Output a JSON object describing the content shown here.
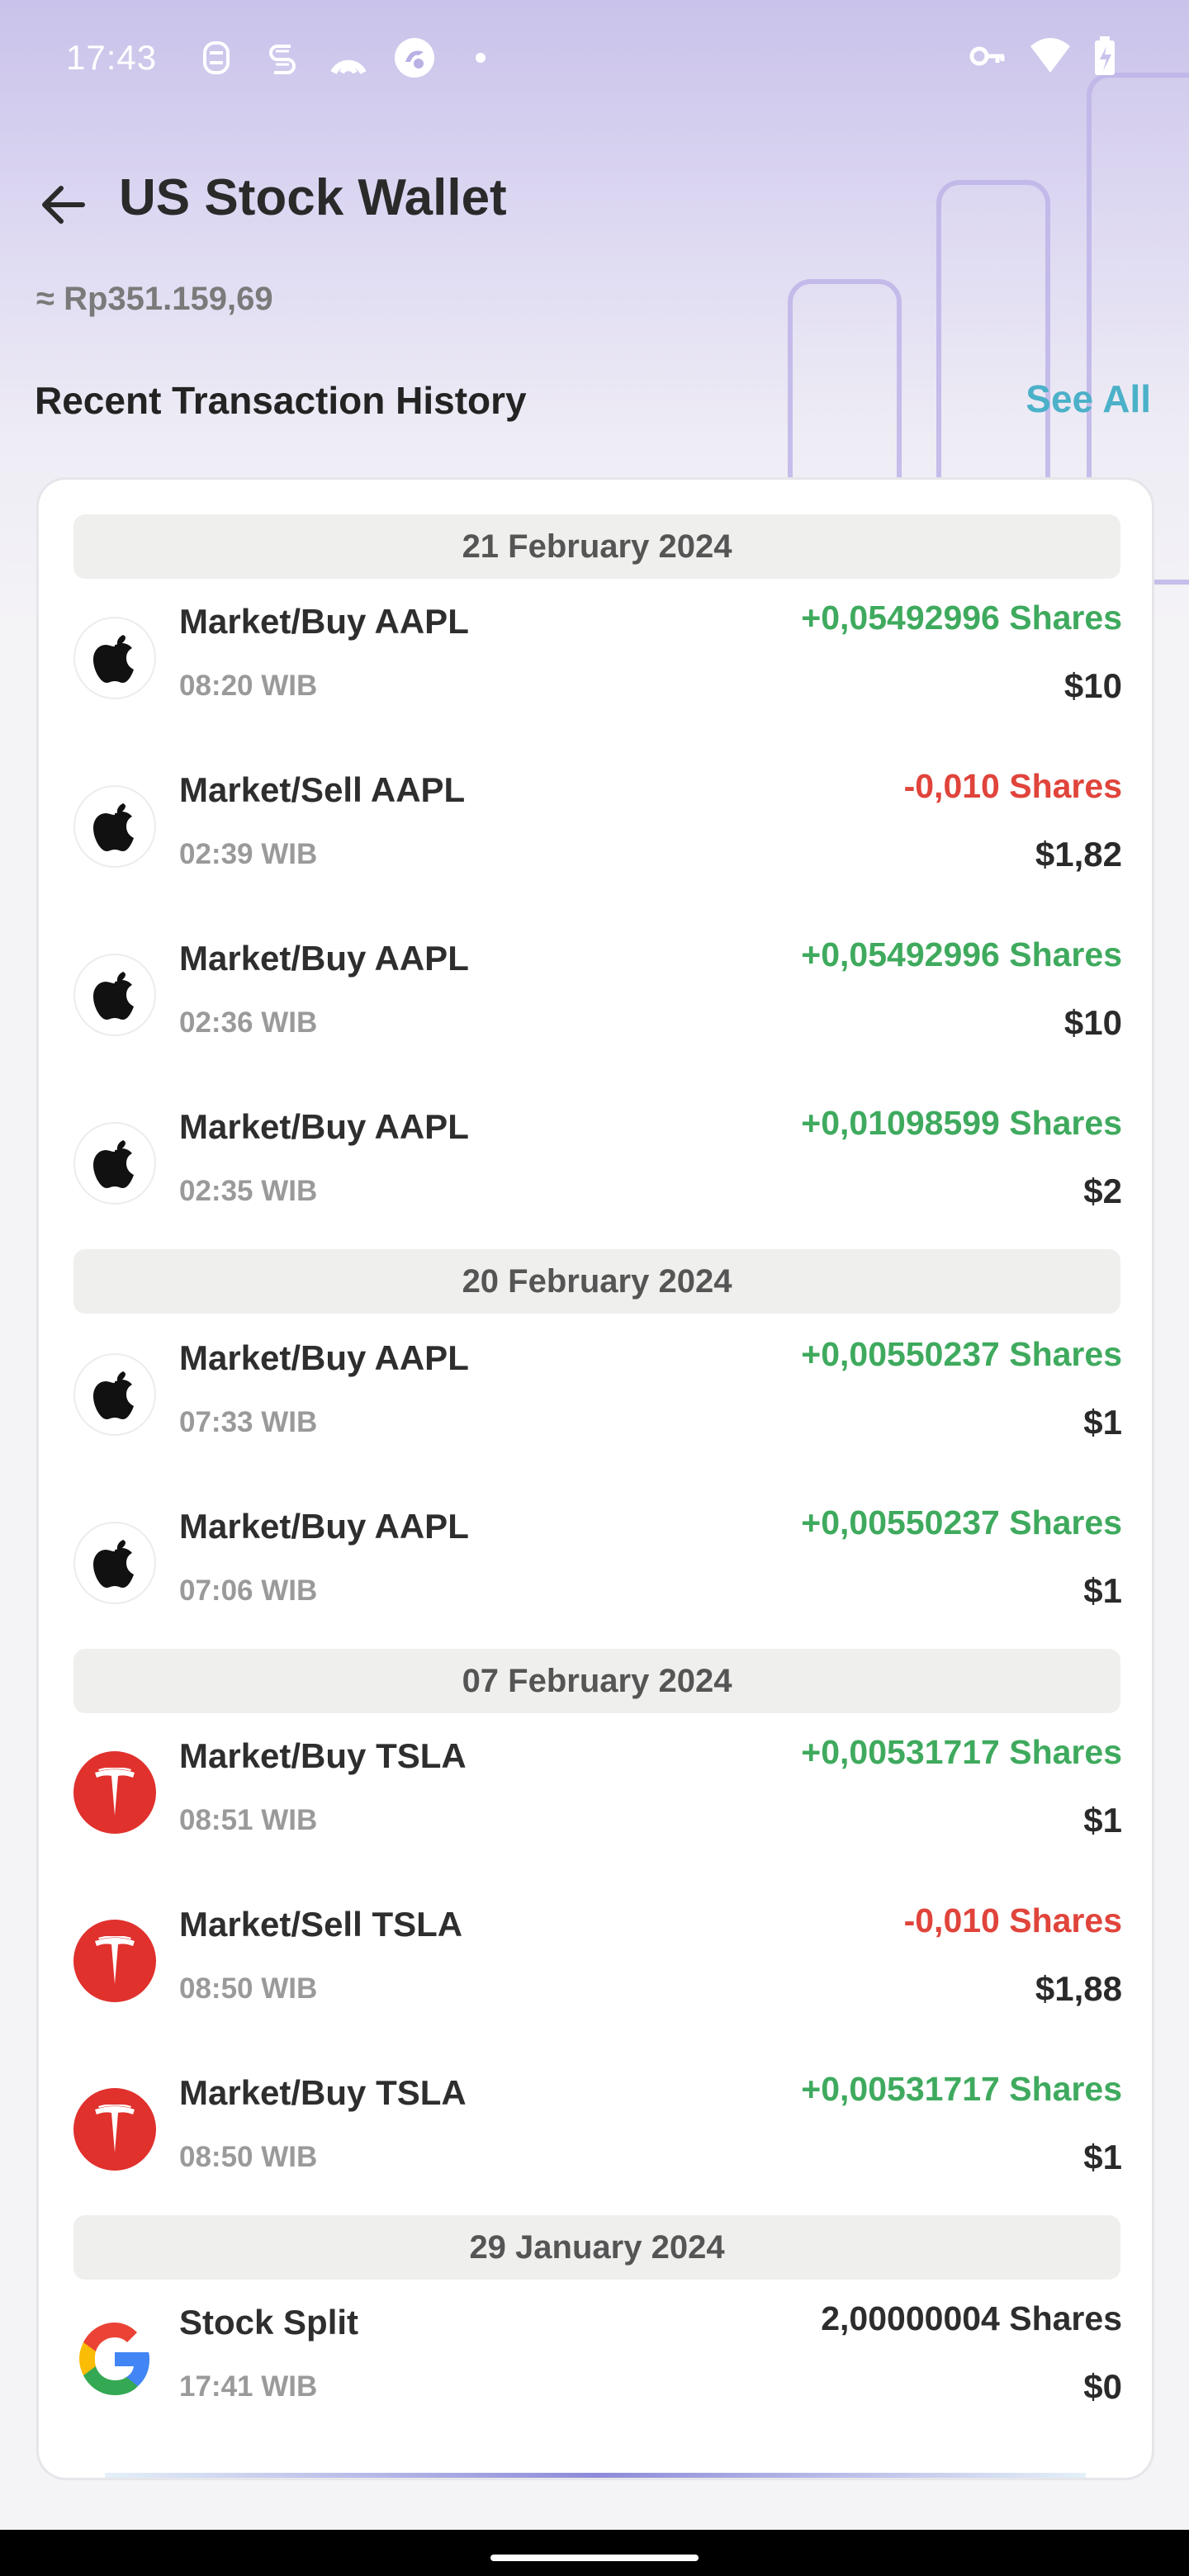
{
  "status_bar": {
    "time": "17:43",
    "left_icons": [
      "notification-s-icon",
      "notification-s2-icon",
      "app-arc-icon",
      "app-circle-icon",
      "dot-icon"
    ],
    "right_icons": [
      "key-icon",
      "wifi-icon",
      "battery-icon"
    ]
  },
  "header": {
    "title": "US Stock Wallet",
    "back_icon": "arrow-left-icon",
    "balance": "≈ Rp351.159,69"
  },
  "history": {
    "title": "Recent Transaction History",
    "see_all_label": "See All",
    "groups": [
      {
        "date": "21 February 2024",
        "items": [
          {
            "logo": "apple-logo-icon",
            "title": "Market/Buy AAPL",
            "time": "08:20 WIB",
            "shares": "+0,05492996 Shares",
            "amount": "$10",
            "direction": "buy"
          },
          {
            "logo": "apple-logo-icon",
            "title": "Market/Sell AAPL",
            "time": "02:39 WIB",
            "shares": "-0,010 Shares",
            "amount": "$1,82",
            "direction": "sell"
          },
          {
            "logo": "apple-logo-icon",
            "title": "Market/Buy AAPL",
            "time": "02:36 WIB",
            "shares": "+0,05492996 Shares",
            "amount": "$10",
            "direction": "buy"
          },
          {
            "logo": "apple-logo-icon",
            "title": "Market/Buy AAPL",
            "time": "02:35 WIB",
            "shares": "+0,01098599 Shares",
            "amount": "$2",
            "direction": "buy"
          }
        ]
      },
      {
        "date": "20 February 2024",
        "items": [
          {
            "logo": "apple-logo-icon",
            "title": "Market/Buy AAPL",
            "time": "07:33 WIB",
            "shares": "+0,00550237 Shares",
            "amount": "$1",
            "direction": "buy"
          },
          {
            "logo": "apple-logo-icon",
            "title": "Market/Buy AAPL",
            "time": "07:06 WIB",
            "shares": "+0,00550237 Shares",
            "amount": "$1",
            "direction": "buy"
          }
        ]
      },
      {
        "date": "07 February 2024",
        "items": [
          {
            "logo": "tesla-logo-icon",
            "title": "Market/Buy TSLA",
            "time": "08:51 WIB",
            "shares": "+0,00531717 Shares",
            "amount": "$1",
            "direction": "buy"
          },
          {
            "logo": "tesla-logo-icon",
            "title": "Market/Sell TSLA",
            "time": "08:50 WIB",
            "shares": "-0,010 Shares",
            "amount": "$1,88",
            "direction": "sell"
          },
          {
            "logo": "tesla-logo-icon",
            "title": "Market/Buy TSLA",
            "time": "08:50 WIB",
            "shares": "+0,00531717 Shares",
            "amount": "$1",
            "direction": "buy"
          }
        ]
      },
      {
        "date": "29 January 2024",
        "items": [
          {
            "logo": "google-logo-icon",
            "title": "Stock Split",
            "time": "17:41 WIB",
            "shares": "2,00000004 Shares",
            "amount": "$0",
            "direction": "neutral"
          }
        ]
      }
    ]
  },
  "colors": {
    "buy": "#3faa5e",
    "sell": "#e0443b",
    "accent": "#4bb1c9",
    "tesla": "#e0312d"
  }
}
